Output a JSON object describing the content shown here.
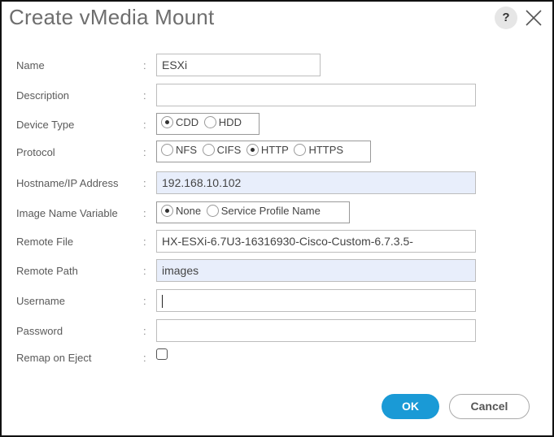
{
  "dialog": {
    "title": "Create vMedia Mount",
    "help_label": "?",
    "close_icon": "close-icon"
  },
  "form": {
    "colon": ":",
    "name": {
      "label": "Name",
      "value": "ESXi"
    },
    "description": {
      "label": "Description",
      "value": ""
    },
    "device_type": {
      "label": "Device Type",
      "options": [
        {
          "label": "CDD",
          "checked": true
        },
        {
          "label": "HDD",
          "checked": false
        }
      ]
    },
    "protocol": {
      "label": "Protocol",
      "options": [
        {
          "label": "NFS",
          "checked": false
        },
        {
          "label": "CIFS",
          "checked": false
        },
        {
          "label": "HTTP",
          "checked": true
        },
        {
          "label": "HTTPS",
          "checked": false
        }
      ]
    },
    "hostname": {
      "label": "Hostname/IP Address",
      "value": "192.168.10.102"
    },
    "image_name_variable": {
      "label": "Image Name Variable",
      "options": [
        {
          "label": "None",
          "checked": true
        },
        {
          "label": "Service Profile Name",
          "checked": false
        }
      ]
    },
    "remote_file": {
      "label": "Remote File",
      "value": "HX-ESXi-6.7U3-16316930-Cisco-Custom-6.7.3.5-"
    },
    "remote_path": {
      "label": "Remote Path",
      "value": "images"
    },
    "username": {
      "label": "Username",
      "value": ""
    },
    "password": {
      "label": "Password",
      "value": ""
    },
    "remap_on_eject": {
      "label": "Remap on Eject",
      "checked": false
    }
  },
  "buttons": {
    "ok": "OK",
    "cancel": "Cancel"
  }
}
